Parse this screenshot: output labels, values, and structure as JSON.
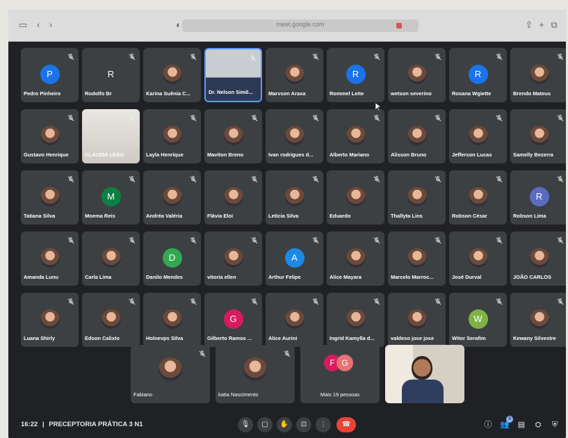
{
  "browser": {
    "url": "meet.google.com"
  },
  "participants": [
    {
      "name": "Pedro Pinheiro",
      "type": "initial",
      "initial": "P",
      "color": "#1a73e8"
    },
    {
      "name": "Rodolfo Br",
      "type": "initial",
      "initial": "R",
      "color": "#3c4043"
    },
    {
      "name": "Karina Suênia C...",
      "type": "photo"
    },
    {
      "name": "Dr. Nelson Simõ...",
      "type": "video",
      "active": true
    },
    {
      "name": "Marvson Araxa",
      "type": "photo"
    },
    {
      "name": "Rommel Leite",
      "type": "initial",
      "initial": "R",
      "color": "#1a73e8"
    },
    {
      "name": "wetson severino",
      "type": "photo"
    },
    {
      "name": "Rosana Wgiette",
      "type": "initial",
      "initial": "R",
      "color": "#1a73e8"
    },
    {
      "name": "Brendo Mateus",
      "type": "photo"
    },
    {
      "name": "Gustavo Henrique",
      "type": "photo"
    },
    {
      "name": "CLAUDIA LEÃO",
      "type": "video"
    },
    {
      "name": "Layla Henrique",
      "type": "photo"
    },
    {
      "name": "Maviton Breno",
      "type": "photo"
    },
    {
      "name": "Ivan rodrigues d...",
      "type": "photo"
    },
    {
      "name": "Alberto Mariano",
      "type": "photo"
    },
    {
      "name": "Alisson Bruno",
      "type": "photo"
    },
    {
      "name": "Jefferson Lucas",
      "type": "photo"
    },
    {
      "name": "Samelly Bezerra",
      "type": "photo"
    },
    {
      "name": "Tatiana Silva",
      "type": "photo"
    },
    {
      "name": "Moema Reis",
      "type": "initial",
      "initial": "M",
      "color": "#0b8043"
    },
    {
      "name": "Andréa Valéria",
      "type": "photo"
    },
    {
      "name": "Flávia Eloi",
      "type": "photo"
    },
    {
      "name": "Leticia Silva",
      "type": "photo"
    },
    {
      "name": "Eduardo",
      "type": "photo"
    },
    {
      "name": "Thallyta Lins",
      "type": "photo"
    },
    {
      "name": "Robson César",
      "type": "photo"
    },
    {
      "name": "Robson Lima",
      "type": "initial",
      "initial": "R",
      "color": "#5c6bc0"
    },
    {
      "name": "Amanda Lunu",
      "type": "photo"
    },
    {
      "name": "Carla Lima",
      "type": "photo"
    },
    {
      "name": "Danilo Mendes",
      "type": "initial",
      "initial": "D",
      "color": "#33a852"
    },
    {
      "name": "vitoria ellen",
      "type": "photo"
    },
    {
      "name": "Arthur Felipe",
      "type": "initial",
      "initial": "A",
      "color": "#1e88e5"
    },
    {
      "name": "Alice Mayara",
      "type": "photo"
    },
    {
      "name": "Marcelo Marroc...",
      "type": "photo"
    },
    {
      "name": "José Durval",
      "type": "photo"
    },
    {
      "name": "JOÃO CARLOS",
      "type": "photo"
    },
    {
      "name": "Luana Shirly",
      "type": "photo"
    },
    {
      "name": "Edson Calixto",
      "type": "photo"
    },
    {
      "name": "Holnevps Silva",
      "type": "photo"
    },
    {
      "name": "Gilberto Ramos ...",
      "type": "initial",
      "initial": "G",
      "color": "#d81b60"
    },
    {
      "name": "Alice Aurini",
      "type": "photo"
    },
    {
      "name": "Ingrid Kamylla d...",
      "type": "photo"
    },
    {
      "name": "valdeso jose jose",
      "type": "photo"
    },
    {
      "name": "Witor Serafim",
      "type": "initial",
      "initial": "W",
      "color": "#7cb342"
    },
    {
      "name": "Kewany Silvestre",
      "type": "photo"
    }
  ],
  "bottom_tiles": [
    {
      "name": "Fabiano",
      "type": "photo"
    },
    {
      "name": "katia Nascimento",
      "type": "photo"
    },
    {
      "name": "Mais 19 pessoas",
      "type": "more",
      "initials": [
        "F",
        "G"
      ]
    },
    {
      "name": "",
      "type": "self-video"
    }
  ],
  "bottombar": {
    "time": "16:22",
    "separator": "|",
    "meeting_name": "PRECEPTORIA PRÁTICA 3 N1",
    "controls": [
      "mic-icon",
      "camera-icon",
      "raise-hand-icon",
      "present-icon",
      "more-icon",
      "hangup-icon"
    ],
    "participants_count": "9"
  },
  "colors": {
    "background": "#202124",
    "tile": "#3c4043",
    "active_border": "#5b9bff",
    "hangup": "#ea4335"
  }
}
